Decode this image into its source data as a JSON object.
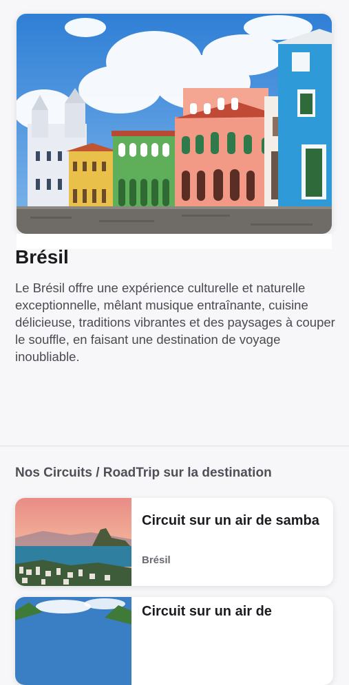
{
  "destination": {
    "name": "Brésil",
    "description": "Le Brésil offre une expérience culturelle et naturelle exceptionnelle, mêlant musique entraînante, cuisine délicieuse, traditions vibrantes et des paysages à couper le souffle, en faisant une destination de voyage inoubliable."
  },
  "circuits_section": {
    "title": "Nos Circuits / RoadTrip sur la destination",
    "items": [
      {
        "title": "Circuit sur un air de samba",
        "country": "Brésil"
      },
      {
        "title": "Circuit sur un air de",
        "country": ""
      }
    ]
  }
}
